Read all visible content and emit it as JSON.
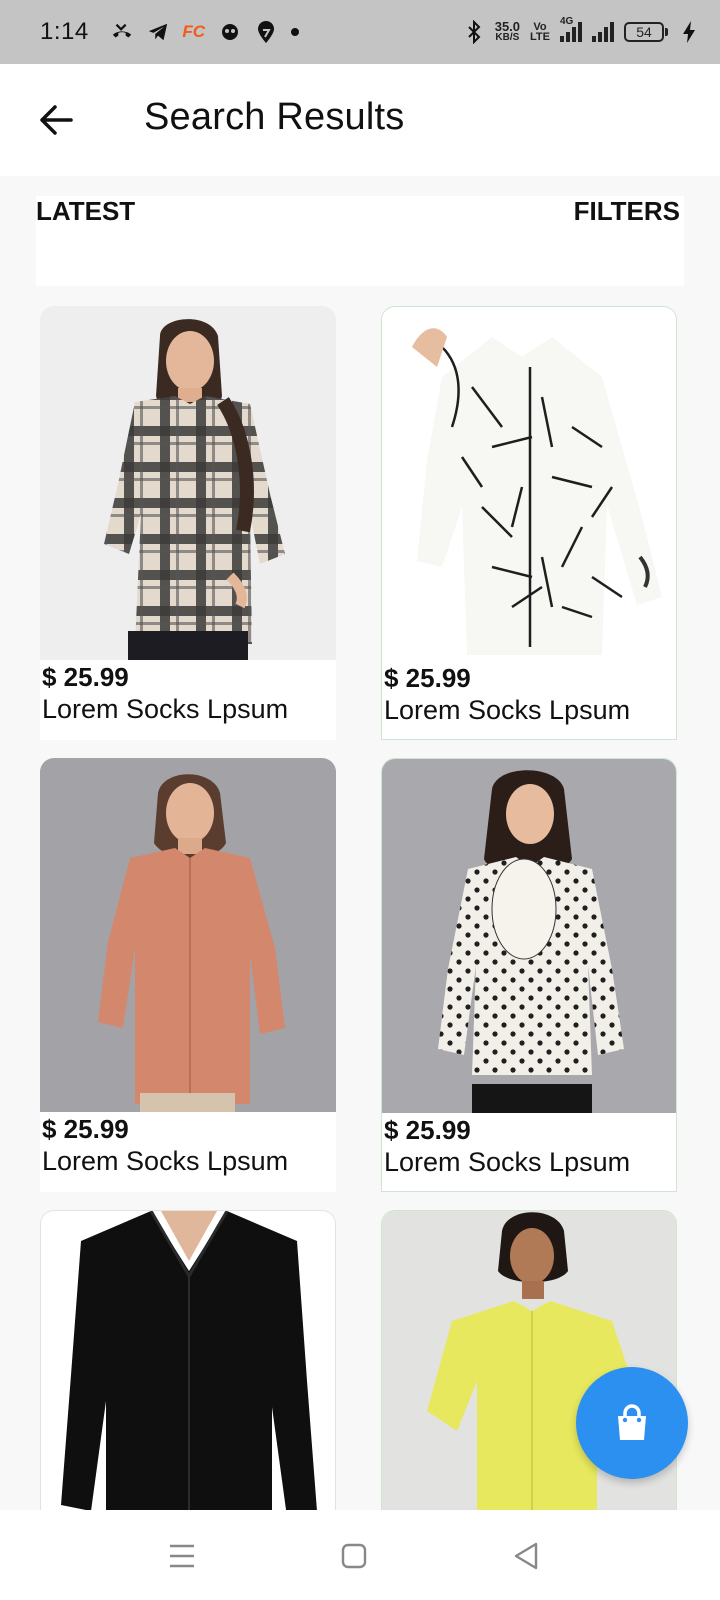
{
  "status_bar": {
    "time": "1:14",
    "net_speed_value": "35.0",
    "net_speed_unit": "KB/S",
    "volte_top": "Vo",
    "volte_bottom": "LTE",
    "network_type": "4G",
    "battery_level": "54",
    "icons": [
      "missed-call-icon",
      "telegram-icon",
      "fc-app-icon",
      "chat-app-icon",
      "swiggy-icon",
      "bluetooth-icon",
      "charging-icon"
    ],
    "fc_label": "FC"
  },
  "header": {
    "title": "Search Results",
    "back_icon": "arrow-left-icon"
  },
  "filter_bar": {
    "sort_label": "LATEST",
    "filter_label": "FILTERS"
  },
  "products": [
    {
      "price": "$ 25.99",
      "name": "Lorem Socks Lpsum",
      "image": "beige plaid shirt on model"
    },
    {
      "price": "$ 25.99",
      "name": "Lorem Socks Lpsum",
      "image": "white shirt with black line print"
    },
    {
      "price": "$ 25.99",
      "name": "Lorem Socks Lpsum",
      "image": "peach button-down shirt on model"
    },
    {
      "price": "$ 25.99",
      "name": "Lorem Socks Lpsum",
      "image": "white polka dot ruffle blouse"
    },
    {
      "price": "",
      "name": "",
      "image": "black button-down shirt"
    },
    {
      "price": "",
      "name": "",
      "image": "yellow short-sleeve shirt on model"
    }
  ],
  "fab": {
    "icon": "shopping-bag-icon",
    "color": "#2b90f0"
  },
  "system_nav": {
    "icons": [
      "menu-icon",
      "home-square-icon",
      "back-triangle-icon"
    ]
  }
}
